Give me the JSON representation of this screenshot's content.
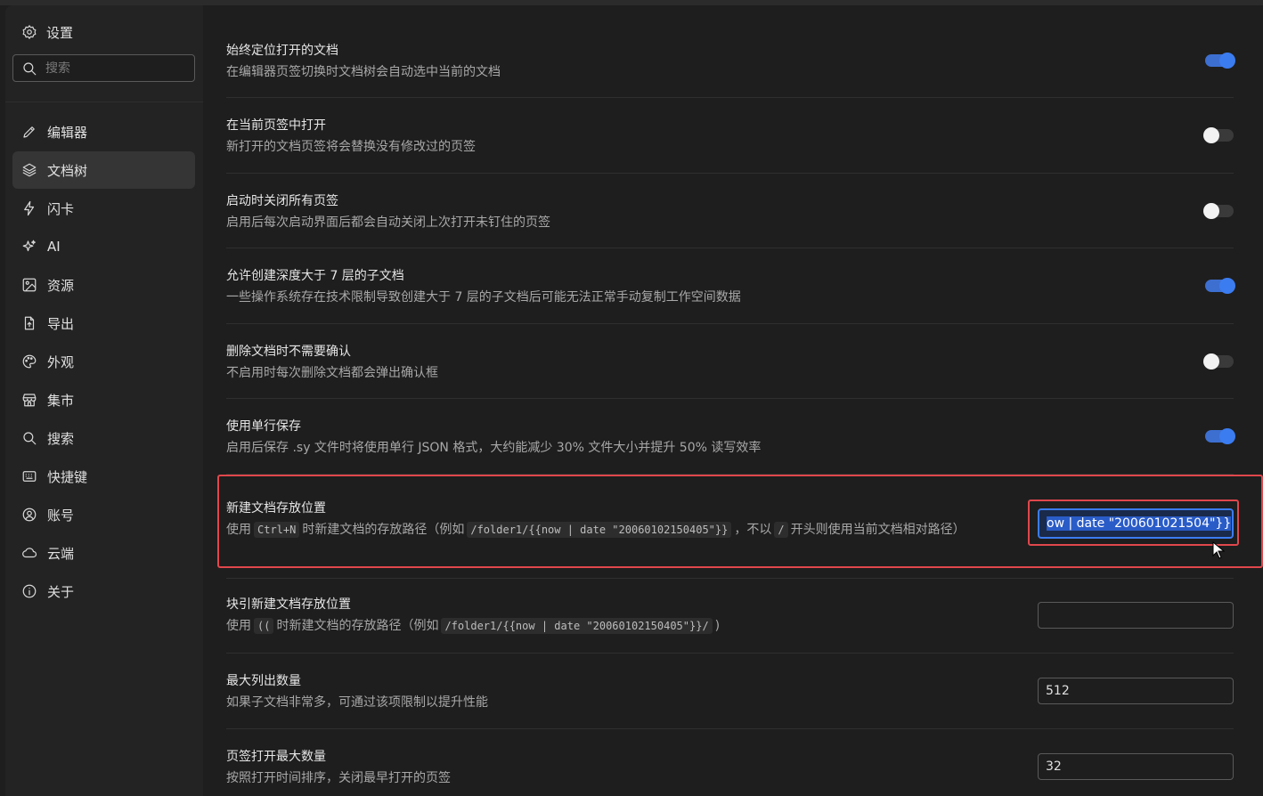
{
  "sidebar": {
    "title": "设置",
    "search_placeholder": "搜索",
    "items": [
      {
        "label": "编辑器",
        "icon": "pencil-icon"
      },
      {
        "label": "文档树",
        "icon": "layers-icon"
      },
      {
        "label": "闪卡",
        "icon": "flash-icon"
      },
      {
        "label": "AI",
        "icon": "sparkle-icon"
      },
      {
        "label": "资源",
        "icon": "image-icon"
      },
      {
        "label": "导出",
        "icon": "export-file-icon"
      },
      {
        "label": "外观",
        "icon": "palette-icon"
      },
      {
        "label": "集市",
        "icon": "store-icon"
      },
      {
        "label": "搜索",
        "icon": "search-icon"
      },
      {
        "label": "快捷键",
        "icon": "keyboard-icon"
      },
      {
        "label": "账号",
        "icon": "account-icon"
      },
      {
        "label": "云端",
        "icon": "cloud-icon"
      },
      {
        "label": "关于",
        "icon": "info-icon"
      }
    ],
    "active_index": 1
  },
  "settings": {
    "always_locate": {
      "title": "始终定位打开的文档",
      "desc": "在编辑器页签切换时文档树会自动选中当前的文档",
      "enabled": true
    },
    "open_in_current_tab": {
      "title": "在当前页签中打开",
      "desc": "新打开的文档页签将会替换没有修改过的页签",
      "enabled": false
    },
    "close_tabs_on_start": {
      "title": "启动时关闭所有页签",
      "desc": "启用后每次启动界面后都会自动关闭上次打开未钉住的页签",
      "enabled": false
    },
    "allow_deep_docs": {
      "title": "允许创建深度大于 7 层的子文档",
      "desc": "一些操作系统存在技术限制导致创建大于 7 层的子文档后可能无法正常手动复制工作空间数据",
      "enabled": true
    },
    "no_delete_confirm": {
      "title": "删除文档时不需要确认",
      "desc": "不启用时每次删除文档都会弹出确认框",
      "enabled": false
    },
    "single_line_save": {
      "title": "使用单行保存",
      "desc": "启用后保存 .sy 文件时将使用单行 JSON 格式，大约能减少 30% 文件大小并提升 50% 读写效率",
      "enabled": true
    },
    "new_doc_path": {
      "title": "新建文档存放位置",
      "desc_parts": [
        "使用",
        "Ctrl+N",
        "时新建文档的存放路径（例如",
        "/folder1/{{now | date \"20060102150405\"}}",
        "，不以",
        "/",
        "开头则使用当前文档相对路径）"
      ],
      "value": "ow | date \"200601021504\"}}"
    },
    "ref_new_doc_path": {
      "title": "块引新建文档存放位置",
      "desc_parts": [
        "使用",
        "((",
        "时新建文档的存放路径（例如",
        "/folder1/{{now | date \"20060102150405\"}}/",
        ")"
      ],
      "value": ""
    },
    "max_list_count": {
      "title": "最大列出数量",
      "desc": "如果子文档非常多，可通过该项限制以提升性能",
      "value": "512"
    },
    "max_open_tabs": {
      "title": "页签打开最大数量",
      "desc": "按照打开时间排序，关闭最早打开的页签",
      "value": "32"
    }
  }
}
